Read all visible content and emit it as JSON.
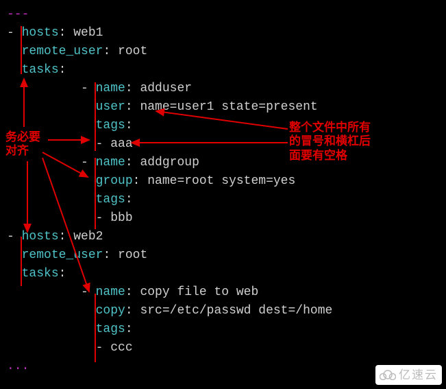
{
  "ellipsis_top": "---",
  "ellipsis_bottom": "...",
  "play1": {
    "hosts_key": "hosts",
    "hosts_val": "web1",
    "remote_user_key": "remote_user",
    "remote_user_val": "root",
    "tasks_key": "tasks",
    "task1": {
      "name_key": "name",
      "name_val": "adduser",
      "user_key": "user",
      "user_val": "name=user1 state=present",
      "tags_key": "tags",
      "tag_val": "aaa"
    },
    "task2": {
      "name_key": "name",
      "name_val": "addgroup",
      "group_key": "group",
      "group_val": "name=root system=yes",
      "tags_key": "tags",
      "tag_val": "bbb"
    }
  },
  "play2": {
    "hosts_key": "hosts",
    "hosts_val": "web2",
    "remote_user_key": "remote_user",
    "remote_user_val": "root",
    "tasks_key": "tasks",
    "task1": {
      "name_key": "name",
      "name_val": "copy file to web",
      "copy_key": "copy",
      "copy_val": "src=/etc/passwd dest=/home",
      "tags_key": "tags",
      "tag_val": "ccc"
    }
  },
  "annotations": {
    "align_note_l1": "务必要",
    "align_note_l2": "对齐",
    "space_note_l1": "整个文件中所有",
    "space_note_l2": "的冒号和横杠后",
    "space_note_l3": "面要有空格"
  },
  "watermark_text": "亿速云"
}
